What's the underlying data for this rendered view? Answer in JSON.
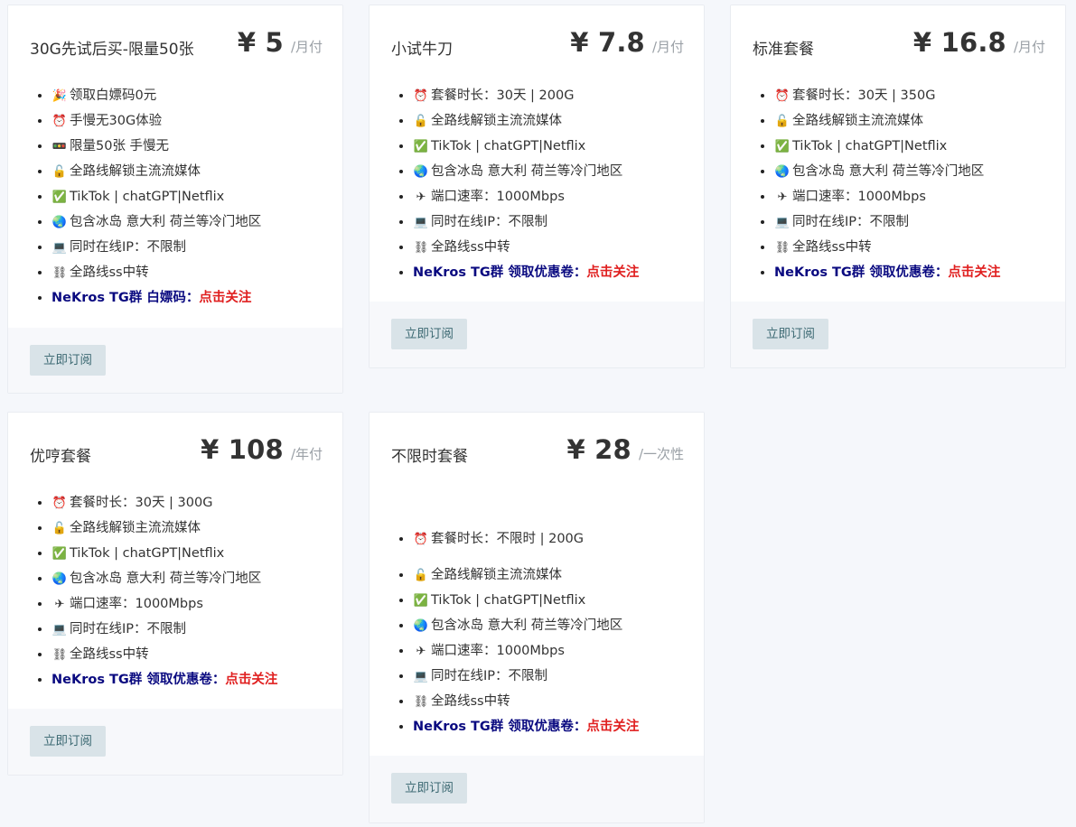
{
  "plans": [
    {
      "name": "30G先试后买-限量50张",
      "price": "¥ 5",
      "period": "/月付",
      "features": [
        {
          "icon": "party-popper",
          "glyph": "🎉",
          "text": "领取白嫖码0元"
        },
        {
          "icon": "alarm-clock",
          "glyph": "⏰",
          "text": "手慢无30G体验"
        },
        {
          "icon": "traffic-light",
          "glyph": "🚥",
          "text": "限量50张 手慢无"
        },
        {
          "icon": "unlock",
          "glyph": "🔓",
          "text": "全路线解锁主流流媒体"
        },
        {
          "icon": "check-mark",
          "glyph": "✅",
          "text": "TikTok | chatGPT|Netflix"
        },
        {
          "icon": "globe",
          "glyph": "🌏",
          "text": "包含冰岛 意大利 荷兰等冷门地区"
        },
        {
          "icon": "laptop",
          "glyph": "💻",
          "text": "同时在线IP：不限制"
        },
        {
          "icon": "chain",
          "glyph": "⛓",
          "text": "全路线ss中转"
        }
      ],
      "promo_label": "NeKros TG群 白嫖码：",
      "promo_link": "点击关注",
      "button": "立即订阅"
    },
    {
      "name": "小试牛刀",
      "price": "¥ 7.8",
      "period": "/月付",
      "features": [
        {
          "icon": "alarm-clock",
          "glyph": "⏰",
          "text": "套餐时长：30天 | 200G"
        },
        {
          "icon": "unlock",
          "glyph": "🔓",
          "text": "全路线解锁主流流媒体"
        },
        {
          "icon": "check-mark",
          "glyph": "✅",
          "text": "TikTok | chatGPT|Netflix"
        },
        {
          "icon": "globe",
          "glyph": "🌏",
          "text": "包含冰岛 意大利 荷兰等冷门地区"
        },
        {
          "icon": "airplane",
          "glyph": "✈",
          "text": "端口速率：1000Mbps"
        },
        {
          "icon": "laptop",
          "glyph": "💻",
          "text": "同时在线IP：不限制"
        },
        {
          "icon": "chain",
          "glyph": "⛓",
          "text": "全路线ss中转"
        }
      ],
      "promo_label": "NeKros TG群 领取优惠卷：",
      "promo_link": "点击关注",
      "button": "立即订阅"
    },
    {
      "name": "标准套餐",
      "price": "¥ 16.8",
      "period": "/月付",
      "features": [
        {
          "icon": "alarm-clock",
          "glyph": "⏰",
          "text": "套餐时长：30天 | 350G"
        },
        {
          "icon": "unlock",
          "glyph": "🔓",
          "text": "全路线解锁主流流媒体"
        },
        {
          "icon": "check-mark",
          "glyph": "✅",
          "text": "TikTok | chatGPT|Netflix"
        },
        {
          "icon": "globe",
          "glyph": "🌏",
          "text": "包含冰岛 意大利 荷兰等冷门地区"
        },
        {
          "icon": "airplane",
          "glyph": "✈",
          "text": "端口速率：1000Mbps"
        },
        {
          "icon": "laptop",
          "glyph": "💻",
          "text": "同时在线IP：不限制"
        },
        {
          "icon": "chain",
          "glyph": "⛓",
          "text": "全路线ss中转"
        }
      ],
      "promo_label": "NeKros TG群 领取优惠卷：",
      "promo_link": "点击关注",
      "button": "立即订阅"
    },
    {
      "name": "优哼套餐",
      "price": "¥ 108",
      "period": "/年付",
      "features": [
        {
          "icon": "alarm-clock",
          "glyph": "⏰",
          "text": "套餐时长：30天 | 300G"
        },
        {
          "icon": "unlock",
          "glyph": "🔓",
          "text": "全路线解锁主流流媒体"
        },
        {
          "icon": "check-mark",
          "glyph": "✅",
          "text": "TikTok | chatGPT|Netflix"
        },
        {
          "icon": "globe",
          "glyph": "🌏",
          "text": "包含冰岛 意大利 荷兰等冷门地区"
        },
        {
          "icon": "airplane",
          "glyph": "✈",
          "text": "端口速率：1000Mbps"
        },
        {
          "icon": "laptop",
          "glyph": "💻",
          "text": "同时在线IP：不限制"
        },
        {
          "icon": "chain",
          "glyph": "⛓",
          "text": "全路线ss中转"
        }
      ],
      "promo_label": "NeKros TG群 领取优惠卷：",
      "promo_link": "点击关注",
      "button": "立即订阅"
    },
    {
      "name": "不限时套餐",
      "price": "¥ 28",
      "period": "/一次性",
      "features": [
        {
          "icon": "alarm-clock",
          "glyph": "⏰",
          "text": "套餐时长：不限时 | 200G"
        },
        {
          "icon": "unlock",
          "glyph": "🔓",
          "text": "全路线解锁主流流媒体"
        },
        {
          "icon": "check-mark",
          "glyph": "✅",
          "text": "TikTok | chatGPT|Netflix"
        },
        {
          "icon": "globe",
          "glyph": "🌏",
          "text": "包含冰岛 意大利 荷兰等冷门地区"
        },
        {
          "icon": "airplane",
          "glyph": "✈",
          "text": "端口速率：1000Mbps"
        },
        {
          "icon": "laptop",
          "glyph": "💻",
          "text": "同时在线IP：不限制"
        },
        {
          "icon": "chain",
          "glyph": "⛓",
          "text": "全路线ss中转"
        }
      ],
      "promo_label": "NeKros TG群 领取优惠卷：",
      "promo_link": "点击关注",
      "button": "立即订阅"
    }
  ]
}
